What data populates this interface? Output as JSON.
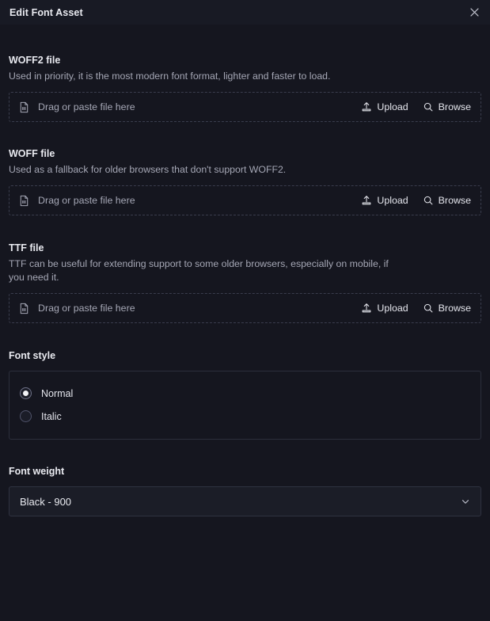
{
  "header": {
    "title": "Edit Font Asset",
    "close_icon": "close-icon"
  },
  "colors": {
    "background": "#15161f",
    "header_background": "#181a24",
    "text_primary": "#e9eaf0",
    "text_muted": "#a5a7b5",
    "border_dashed": "#3a3d4d",
    "border_solid": "#2c2f3c",
    "select_background": "#1b1d27",
    "radio_dot": "#f2f3f7"
  },
  "dropzone_common": {
    "placeholder": "Drag or paste file here",
    "file_icon": "file-icon",
    "upload_label": "Upload",
    "upload_icon": "upload-icon",
    "browse_label": "Browse",
    "browse_icon": "search-icon"
  },
  "sections": {
    "woff2": {
      "label": "WOFF2 file",
      "description": "Used in priority, it is the most modern font format, lighter and faster to load."
    },
    "woff": {
      "label": "WOFF file",
      "description": "Used as a fallback for older browsers that don't support WOFF2."
    },
    "ttf": {
      "label": "TTF file",
      "description": "TTF can be useful for extending support to some older browsers, especially on mobile, if you need it."
    },
    "font_style": {
      "label": "Font style",
      "options": [
        {
          "label": "Normal",
          "selected": true
        },
        {
          "label": "Italic",
          "selected": false
        }
      ]
    },
    "font_weight": {
      "label": "Font weight",
      "value": "Black - 900",
      "chevron_icon": "chevron-down-icon"
    }
  }
}
